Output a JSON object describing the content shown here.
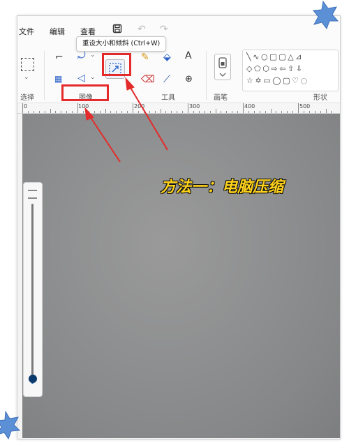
{
  "menu": {
    "file": "文件",
    "edit": "编辑",
    "view": "查看",
    "save_icon": "save-icon",
    "undo_icon": "undo-icon",
    "redo_icon": "redo-icon"
  },
  "tooltip": "重设大小和倾斜 (Ctrl+W)",
  "ribbon": {
    "select_label": "选择",
    "image_label": "图像",
    "tools_label": "工具",
    "brushes_label": "画笔",
    "shapes_label": "形状",
    "tool_text_glyph": "A",
    "shapes_row1": "╲∿○□▢△⊿",
    "shapes_row2": "◇⬠⬡⇨⇦⇧⇩",
    "shapes_row3": "☆✡▭◯▢♡◌"
  },
  "ruler": {
    "labels": [
      "0",
      "100",
      "200",
      "300",
      "400",
      "500"
    ]
  },
  "canvas": {
    "overlay_text": "方法一：电脑压缩"
  },
  "zoom": {
    "level": 0.03
  },
  "colors": {
    "highlight": "#e42a2a",
    "accent": "#1a5fb4",
    "overlay_text": "#ffd21a",
    "star": "#5b8fd6"
  }
}
